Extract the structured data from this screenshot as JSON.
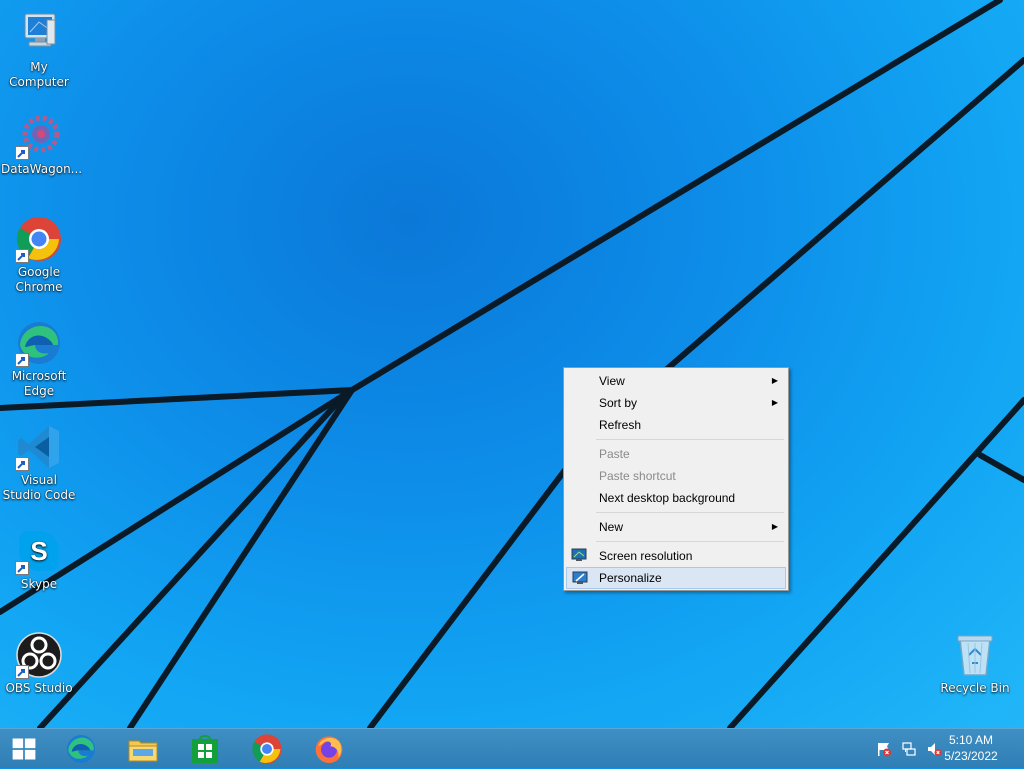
{
  "desktop": {
    "icons": [
      {
        "label": "My Computer"
      },
      {
        "label": "DataWagon..."
      },
      {
        "label": "Google Chrome"
      },
      {
        "label": "Microsoft Edge"
      },
      {
        "label": "Visual Studio Code"
      },
      {
        "label": "Skype"
      },
      {
        "label": "OBS Studio"
      },
      {
        "label": "Recycle Bin"
      }
    ]
  },
  "context_menu": {
    "items": [
      {
        "label": "View",
        "submenu": true
      },
      {
        "label": "Sort by",
        "submenu": true
      },
      {
        "label": "Refresh"
      },
      {
        "label": "Paste",
        "disabled": true
      },
      {
        "label": "Paste shortcut",
        "disabled": true
      },
      {
        "label": "Next desktop background"
      },
      {
        "label": "New",
        "submenu": true
      },
      {
        "label": "Screen resolution",
        "icon": "monitor-icon"
      },
      {
        "label": "Personalize",
        "icon": "personalize-icon",
        "highlighted": true
      }
    ],
    "arrow_glyph": "▶"
  },
  "taskbar": {
    "pinned": [
      "start-icon",
      "edge-icon",
      "file-explorer-icon",
      "store-icon",
      "chrome-icon",
      "firefox-icon"
    ],
    "clock": {
      "time": "5:10 AM",
      "date": "5/23/2022"
    },
    "tray": [
      "action-center-flag-icon",
      "network-icon",
      "volume-muted-icon"
    ]
  },
  "colors": {
    "wallpaper_blue": "#0d8ce8",
    "menu_bg": "#f0f0f0",
    "menu_highlight": "#dbe6f4",
    "taskbar": "#3584bd"
  }
}
